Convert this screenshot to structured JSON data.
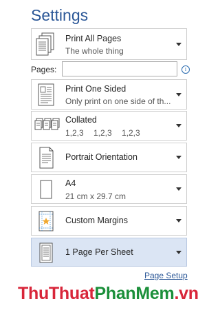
{
  "title": "Settings",
  "print_what": {
    "line1": "Print All Pages",
    "line2": "The whole thing"
  },
  "pages": {
    "label": "Pages:",
    "value": "",
    "info_icon": "info-icon"
  },
  "sides": {
    "line1": "Print One Sided",
    "line2": "Only print on one side of th..."
  },
  "collation": {
    "line1": "Collated",
    "seq": [
      "1,2,3",
      "1,2,3",
      "1,2,3"
    ]
  },
  "orientation": {
    "line1": "Portrait Orientation"
  },
  "paper": {
    "line1": "A4",
    "line2": "21 cm x 29.7 cm"
  },
  "margins": {
    "line1": "Custom Margins"
  },
  "per_sheet": {
    "line1": "1 Page Per Sheet",
    "selected": true
  },
  "page_setup_link": "Page Setup",
  "watermark": {
    "part1": "ThuThuat",
    "part2": "PhanMem",
    "part3": ".vn"
  },
  "colors": {
    "title": "#2b5797",
    "selected_bg": "#dbe5f4",
    "watermark_red": "#d8263a",
    "watermark_green": "#1b8f3a"
  }
}
